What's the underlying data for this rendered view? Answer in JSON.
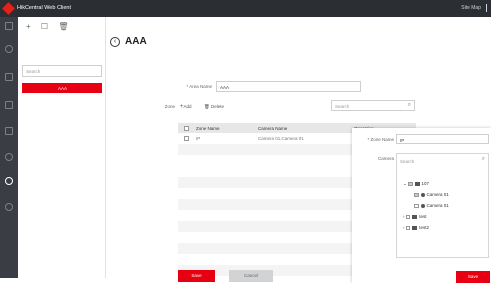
{
  "app": {
    "title": "HikCentral Web Client",
    "site_map": "Site Map",
    "brand_color": "#e60012"
  },
  "sidenav": {
    "icons": [
      "home-icon",
      "eye-icon",
      "monitor-icon",
      "grid-icon",
      "book-icon",
      "shield-icon",
      "contacts-icon",
      "settings-icon"
    ],
    "active_index": 6
  },
  "tree": {
    "toolbar": [
      "add-icon",
      "edit-icon",
      "delete-icon"
    ],
    "search_placeholder": "Search",
    "selected_item": "AAA"
  },
  "page": {
    "title": "AAA",
    "area_name_label": "* Area Name",
    "area_name_value": "AAA",
    "zone_label": "Zone",
    "add_label": "Add",
    "delete_label": "Delete",
    "search_placeholder": "Search"
  },
  "table": {
    "columns": [
      "Zone Name",
      "Camera Name",
      "Operation"
    ],
    "rows": [
      {
        "zone": "IP",
        "camera": "Camera 01,Camera 01"
      }
    ]
  },
  "popup": {
    "zone_name_label": "* Zone Name",
    "zone_name_value": "IP",
    "camera_label": "Camera",
    "search_placeholder": "Search",
    "tree": [
      {
        "label": "107",
        "type": "folder",
        "expanded": true,
        "checked": true
      },
      {
        "label": "Camera 01",
        "type": "camera",
        "checked": true
      },
      {
        "label": "Camera 01",
        "type": "camera",
        "checked": false
      },
      {
        "label": "test",
        "type": "folder",
        "expanded": false,
        "checked": false
      },
      {
        "label": "test2",
        "type": "folder",
        "expanded": false,
        "checked": false
      }
    ],
    "save_label": "Save"
  },
  "footer": {
    "save_label": "Save",
    "cancel_label": "Cancel"
  }
}
